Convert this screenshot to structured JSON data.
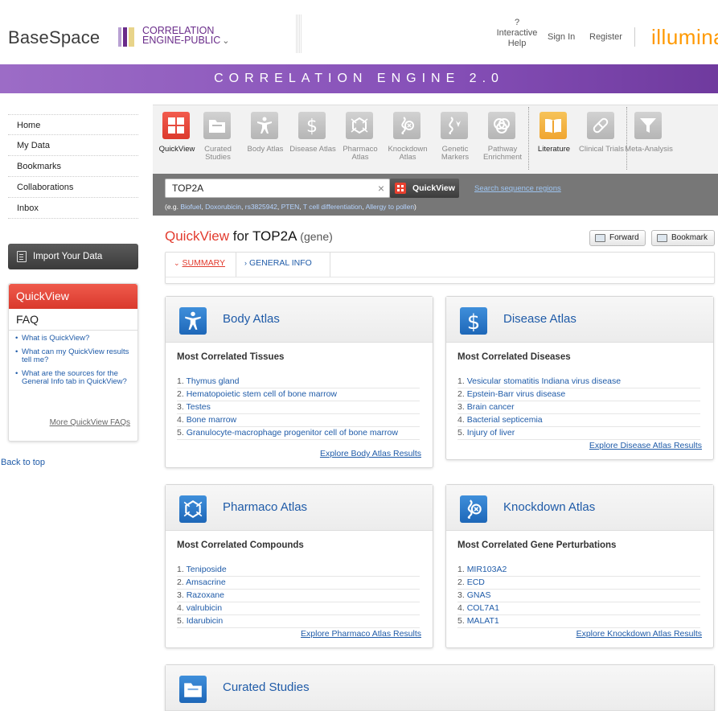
{
  "header": {
    "basespace": "BaseSpace",
    "product_line1": "CORRELATION",
    "product_line2": "ENGINE-PUBLIC",
    "help_q": "?",
    "help_line1": "Interactive",
    "help_line2": "Help",
    "sign_in": "Sign In",
    "register": "Register",
    "illumina": "illumina",
    "banner": "CORRELATION ENGINE 2.0"
  },
  "leftnav": {
    "items": [
      "Home",
      "My Data",
      "Bookmarks",
      "Collaborations",
      "Inbox"
    ],
    "import": "Import Your Data",
    "panel_title": "QuickView",
    "faq_title": "FAQ",
    "faqs": [
      "What is QuickView?",
      "What can my QuickView results tell me?",
      "What are the sources for the General Info tab in QuickView?"
    ],
    "faq_more": "More QuickView FAQs",
    "back_to_top": "Back to top"
  },
  "tools": [
    {
      "label": "QuickView",
      "icon": "quickview-icon"
    },
    {
      "label": "Curated Studies",
      "icon": "folder-icon"
    },
    {
      "label": "Body Atlas",
      "icon": "body-icon"
    },
    {
      "label": "Disease Atlas",
      "icon": "dollar-icon"
    },
    {
      "label": "Pharmaco Atlas",
      "icon": "pharmaco-icon"
    },
    {
      "label": "Knockdown Atlas",
      "icon": "knockdown-icon"
    },
    {
      "label": "Genetic Markers",
      "icon": "gene-icon"
    },
    {
      "label": "Pathway Enrichment",
      "icon": "venn-icon"
    },
    {
      "label": "Literature",
      "icon": "book-icon"
    },
    {
      "label": "Clinical Trials",
      "icon": "pill-icon"
    },
    {
      "label": "Meta-Analysis",
      "icon": "funnel-icon"
    }
  ],
  "search": {
    "value": "TOP2A",
    "button": "QuickView",
    "sequence_link": "Search sequence regions",
    "examples_prefix": "(e.g. ",
    "examples": [
      "Biofuel",
      "Doxorubicin",
      "rs3825942",
      "PTEN",
      "T cell differentiation",
      "Allergy to pollen"
    ],
    "examples_suffix": ")"
  },
  "main": {
    "title_red": "QuickView",
    "title_for": " for ",
    "gene": "TOP2A",
    "gene_type": " (gene)",
    "forward": "Forward",
    "bookmark": "Bookmark",
    "tab_summary": "SUMMARY",
    "tab_general": "GENERAL INFO"
  },
  "cards": {
    "body": {
      "title": "Body Atlas",
      "subtitle": "Most Correlated Tissues",
      "items": [
        "Thymus gland",
        "Hematopoietic stem cell of bone marrow",
        "Testes",
        "Bone marrow",
        "Granulocyte-macrophage progenitor cell of bone marrow"
      ],
      "explore": "Explore Body Atlas Results"
    },
    "disease": {
      "title": "Disease Atlas",
      "subtitle": "Most Correlated Diseases",
      "items": [
        "Vesicular stomatitis Indiana virus disease",
        "Epstein-Barr virus disease",
        "Brain cancer",
        "Bacterial septicemia",
        "Injury of liver"
      ],
      "explore": "Explore Disease Atlas Results"
    },
    "pharmaco": {
      "title": "Pharmaco Atlas",
      "subtitle": "Most Correlated Compounds",
      "items": [
        "Teniposide",
        "Amsacrine",
        "Razoxane",
        "valrubicin",
        "Idarubicin"
      ],
      "explore": "Explore Pharmaco Atlas Results"
    },
    "knockdown": {
      "title": "Knockdown Atlas",
      "subtitle": "Most Correlated Gene Perturbations",
      "items": [
        "MIR103A2",
        "ECD",
        "GNAS",
        "COL7A1",
        "MALAT1"
      ],
      "explore": "Explore Knockdown Atlas Results"
    },
    "curated": {
      "title": "Curated Studies"
    }
  }
}
